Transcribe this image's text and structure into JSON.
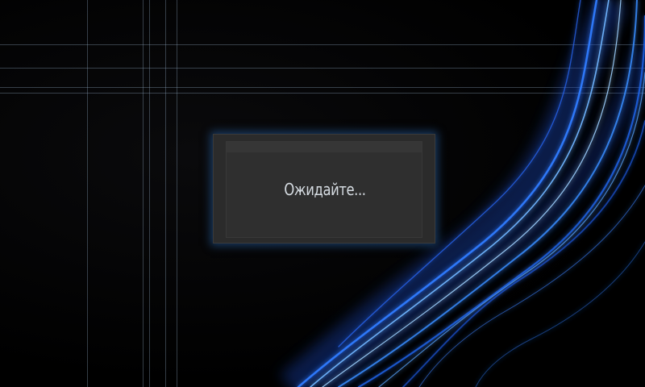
{
  "dialog": {
    "message": "Ожидайте..."
  },
  "background": {
    "color": "#000000",
    "accent_color": "#2a6cff",
    "line_color": "#96afc8"
  }
}
